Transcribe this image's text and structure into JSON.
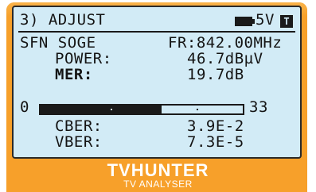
{
  "header": {
    "title": "3) ADJUST",
    "voltage": "5V",
    "mode_badge": "T"
  },
  "channel": {
    "name": "SFN SOGE",
    "frequency": "FR:842.00MHz"
  },
  "power": {
    "label": "POWER:",
    "value": "46.7dBµV"
  },
  "mer": {
    "label": "MER:",
    "value": "19.7dB"
  },
  "mer_bar": {
    "min": "0",
    "max": "33",
    "level_fraction": 0.6
  },
  "cber": {
    "label": "CBER:",
    "value": "3.9E-2"
  },
  "vber": {
    "label": "VBER:",
    "value": "7.3E-5"
  },
  "brand": {
    "name": "TVHUNTER",
    "subtitle": "TV ANALYSER"
  },
  "colors": {
    "device": "#f7a02a",
    "lcd": "#d2ebf6",
    "text": "#141414"
  }
}
